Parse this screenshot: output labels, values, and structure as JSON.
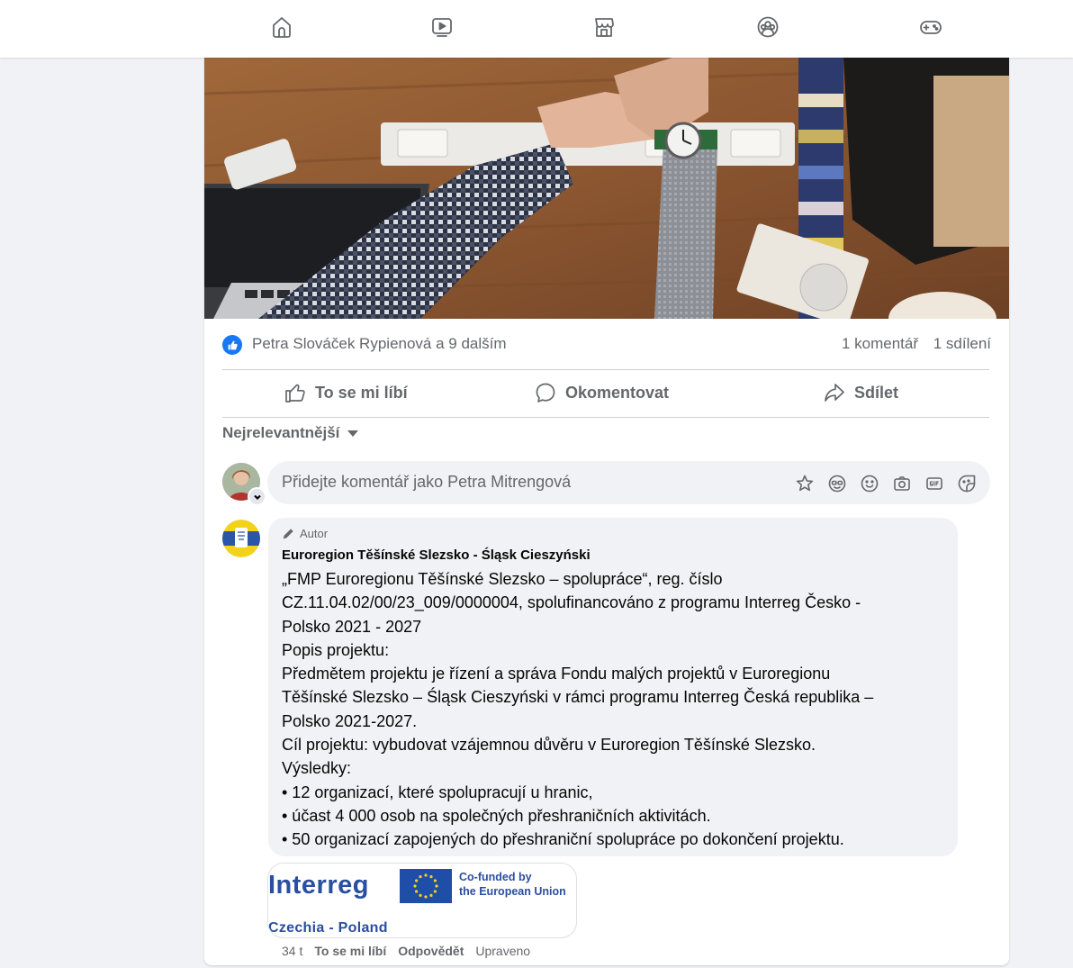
{
  "nav": {
    "icons": [
      "home-icon",
      "video-icon",
      "marketplace-icon",
      "groups-icon",
      "gaming-icon"
    ]
  },
  "post": {
    "reactions": {
      "icon": "like-icon",
      "text": "Petra Slováček Rypienová a 9 dalším",
      "comments": "1 komentář",
      "shares": "1 sdílení"
    },
    "actions": {
      "like": "To se mi líbí",
      "comment": "Okomentovat",
      "share": "Sdílet"
    },
    "sort_label": "Nejrelevantnější",
    "composer": {
      "placeholder": "Přidejte komentář jako Petra Mitrengová",
      "tools": [
        "avatar-sticker-icon",
        "emoji-face-icon",
        "smiley-icon",
        "camera-icon",
        "gif-icon",
        "sticker-icon"
      ]
    },
    "comment": {
      "badge": "Autor",
      "author": "Euroregion Těšínské Slezsko - Śląsk Cieszyński",
      "lines": [
        "„FMP Euroregionu Těšínské Slezsko – spolupráce“, reg. číslo",
        "CZ.11.04.02/00/23_009/0000004, spolufinancováno z programu Interreg Česko -",
        "Polsko 2021 - 2027",
        "Popis projektu:",
        "Předmětem projektu je řízení a správa Fondu malých projektů v Euroregionu",
        "Těšínské Slezsko – Śląsk Cieszyński v rámci programu Interreg Česká republika –",
        "Polsko 2021-2027.",
        "Cíl projektu: vybudovat vzájemnou důvěru v Euroregion Těšínské Slezsko.",
        "Výsledky:",
        "• 12 organizací, které spolupracují u hranic,",
        "• účast 4 000 osob na společných přeshraničních aktivitách.",
        "• 50 organizací zapojených do přeshraniční spolupráce po dokončení projektu."
      ],
      "attachment": {
        "brand": "Interreg",
        "cofunded_line1": "Co-funded by",
        "cofunded_line2": "the European Union",
        "region": "Czechia - Poland"
      },
      "meta": {
        "time": "34 t",
        "like": "To se mi líbí",
        "reply": "Odpovědět",
        "edited": "Upraveno"
      }
    }
  },
  "colors": {
    "page_bg": "#f0f2f5",
    "accent": "#1877f2",
    "secondary_text": "#65676b",
    "interreg_blue": "#2a4ea0"
  }
}
